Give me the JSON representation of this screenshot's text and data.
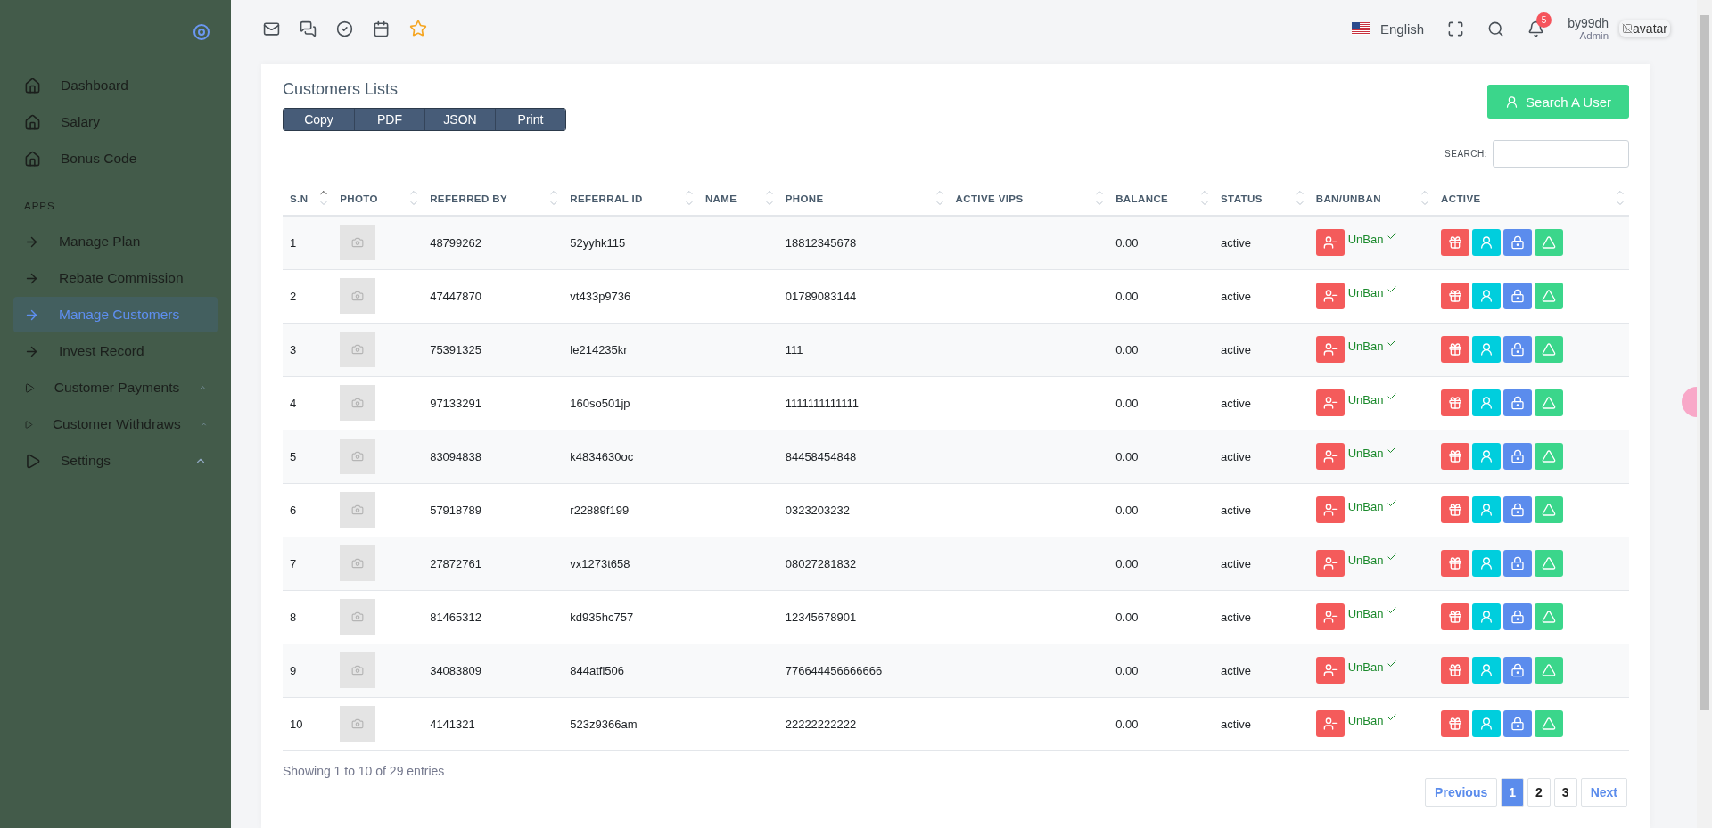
{
  "sidebar": {
    "items": [
      {
        "label": "Dashboard",
        "kind": "home",
        "selected": false
      },
      {
        "label": "Salary",
        "kind": "home",
        "selected": false
      },
      {
        "label": "Bonus Code",
        "kind": "home",
        "selected": false
      },
      {
        "label": "APPS",
        "kind": "heading"
      },
      {
        "label": "Manage Plan",
        "kind": "arrow",
        "selected": false
      },
      {
        "label": "Rebate Commission",
        "kind": "arrow",
        "selected": false
      },
      {
        "label": "Manage Customers",
        "kind": "arrow",
        "selected": true
      },
      {
        "label": "Invest Record",
        "kind": "arrow",
        "selected": false
      },
      {
        "label": "Customer Payments",
        "kind": "group",
        "selected": false
      },
      {
        "label": "Customer Withdraws",
        "kind": "group",
        "selected": false
      },
      {
        "label": "Settings",
        "kind": "group",
        "selected": false
      }
    ]
  },
  "topbar": {
    "language": "English",
    "notifications": "5",
    "user": {
      "name": "by99dh",
      "role": "Admin",
      "avatar_alt": "avatar"
    }
  },
  "card": {
    "title": "Customers Lists",
    "export_buttons": [
      "Copy",
      "PDF",
      "JSON",
      "Print"
    ],
    "search_user_button": "Search A User",
    "search_label": "SEARCH:"
  },
  "table": {
    "columns": [
      {
        "label": "S.N",
        "sorted": true
      },
      {
        "label": "PHOTO",
        "sorted": false
      },
      {
        "label": "REFERRED BY",
        "sorted": false
      },
      {
        "label": "REFERRAL ID",
        "sorted": false
      },
      {
        "label": "NAME",
        "sorted": false
      },
      {
        "label": "PHONE",
        "sorted": false
      },
      {
        "label": "ACTIVE VIPS",
        "sorted": false
      },
      {
        "label": "BALANCE",
        "sorted": false
      },
      {
        "label": "STATUS",
        "sorted": false
      },
      {
        "label": "BAN/UNBAN",
        "sorted": false
      },
      {
        "label": "ACTIVE",
        "sorted": false
      }
    ],
    "rows": [
      {
        "sn": "1",
        "referred_by": "48799262",
        "referral_id": "52yyhk115",
        "phone": "18812345678",
        "balance": "0.00",
        "status": "active",
        "ban": "UnBan"
      },
      {
        "sn": "2",
        "referred_by": "47447870",
        "referral_id": "vt433p9736",
        "phone": "01789083144",
        "balance": "0.00",
        "status": "active",
        "ban": "UnBan"
      },
      {
        "sn": "3",
        "referred_by": "75391325",
        "referral_id": "le214235kr",
        "phone": "111",
        "balance": "0.00",
        "status": "active",
        "ban": "UnBan"
      },
      {
        "sn": "4",
        "referred_by": "97133291",
        "referral_id": "160so501jp",
        "phone": "1111111111111",
        "balance": "0.00",
        "status": "active",
        "ban": "UnBan"
      },
      {
        "sn": "5",
        "referred_by": "83094838",
        "referral_id": "k4834630oc",
        "phone": "84458454848",
        "balance": "0.00",
        "status": "active",
        "ban": "UnBan"
      },
      {
        "sn": "6",
        "referred_by": "57918789",
        "referral_id": "r22889f199",
        "phone": "0323203232",
        "balance": "0.00",
        "status": "active",
        "ban": "UnBan"
      },
      {
        "sn": "7",
        "referred_by": "27872761",
        "referral_id": "vx1273t658",
        "phone": "08027281832",
        "balance": "0.00",
        "status": "active",
        "ban": "UnBan"
      },
      {
        "sn": "8",
        "referred_by": "81465312",
        "referral_id": "kd935hc757",
        "phone": "12345678901",
        "balance": "0.00",
        "status": "active",
        "ban": "UnBan"
      },
      {
        "sn": "9",
        "referred_by": "34083809",
        "referral_id": "844atfi506",
        "phone": "776644456666666",
        "balance": "0.00",
        "status": "active",
        "ban": "UnBan"
      },
      {
        "sn": "10",
        "referred_by": "4141321",
        "referral_id": "523z9366am",
        "phone": "22222222222",
        "balance": "0.00",
        "status": "active",
        "ban": "UnBan"
      }
    ]
  },
  "footer": {
    "info": "Showing 1 to 10 of 29 entries",
    "pagination": [
      {
        "label": "Previous",
        "kind": "nav",
        "selected": false
      },
      {
        "label": "1",
        "kind": "page",
        "selected": true
      },
      {
        "label": "2",
        "kind": "page",
        "selected": false
      },
      {
        "label": "3",
        "kind": "page",
        "selected": false
      },
      {
        "label": "Next",
        "kind": "nav",
        "selected": false
      }
    ]
  }
}
